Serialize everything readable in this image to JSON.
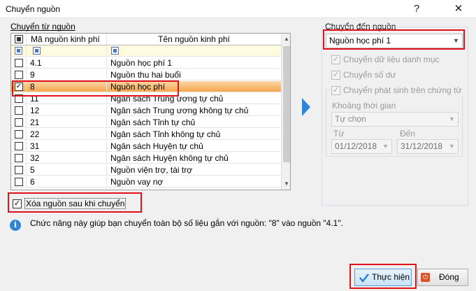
{
  "window": {
    "title": "Chuyển nguồn",
    "help_label": "?",
    "close_label": "✕"
  },
  "source": {
    "group_label": "Chuyển từ nguồn",
    "columns": {
      "code": "Mã nguồn kinh phí",
      "name": "Tên nguồn kinh phí"
    },
    "rows": [
      {
        "code": "4.1",
        "name": "Nguồn học phí 1",
        "checked": false
      },
      {
        "code": "9",
        "name": "Nguồn thu hai buổi",
        "checked": false
      },
      {
        "code": "8",
        "name": "Nguồn học phí",
        "checked": true
      },
      {
        "code": "11",
        "name": "Ngân sách Trung ương tự chủ",
        "checked": false
      },
      {
        "code": "12",
        "name": "Ngân sách Trung ương không tự chủ",
        "checked": false
      },
      {
        "code": "21",
        "name": "Ngân sách Tỉnh tự chủ",
        "checked": false
      },
      {
        "code": "22",
        "name": "Ngân sách Tỉnh không tự chủ",
        "checked": false
      },
      {
        "code": "31",
        "name": "Ngân sách Huyện tự chủ",
        "checked": false
      },
      {
        "code": "32",
        "name": "Ngân sách Huyện không tự chủ",
        "checked": false
      },
      {
        "code": "5",
        "name": "Nguồn viện trợ, tài trợ",
        "checked": false
      },
      {
        "code": "6",
        "name": "Nguồn vay nợ",
        "checked": false
      }
    ],
    "delete_after_label": "Xóa nguồn sau khi chuyển"
  },
  "target": {
    "group_label": "Chuyển đến nguồn",
    "selected_source": "Nguồn học phí 1",
    "options": {
      "transfer_catalog": "Chuyển dữ liệu danh mục",
      "transfer_balance": "Chuyển số dư",
      "transfer_vouchers": "Chuyển phát sinh trên chứng từ"
    },
    "period_label": "Khoảng thời gian",
    "period_value": "Tự chọn",
    "from_label": "Từ",
    "from_value": "01/12/2018",
    "to_label": "Đến",
    "to_value": "31/12/2018"
  },
  "info_text": "Chức năng này giúp bạn chuyển toàn bộ số liệu gắn với nguồn: \"8\" vào nguồn \"4.1\".",
  "buttons": {
    "execute": "Thực hiện",
    "close": "Đóng"
  },
  "colors": {
    "highlight_red": "#e0121a",
    "selected_row": "#f6a74e",
    "accent_blue": "#2f86d6"
  }
}
